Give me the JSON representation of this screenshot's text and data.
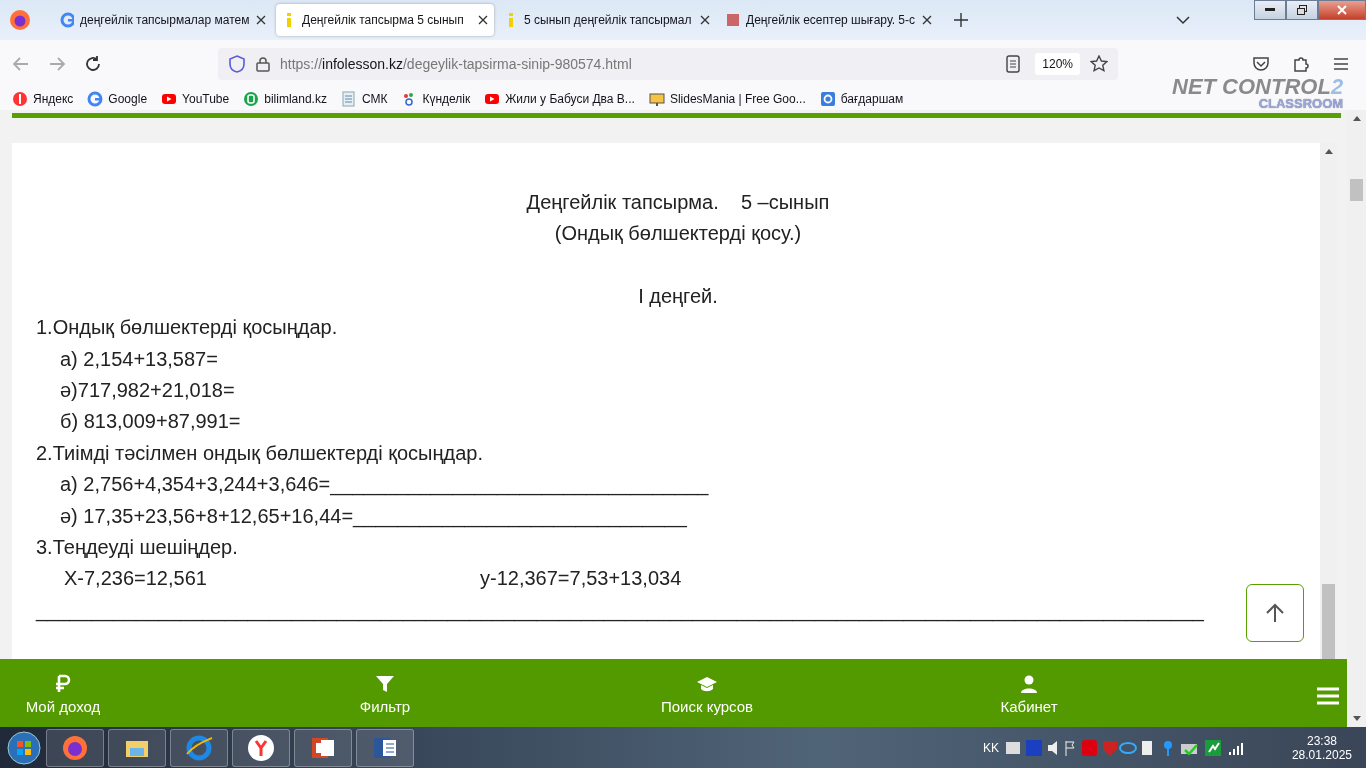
{
  "browser": {
    "tabs": [
      {
        "title": "деңгейлік тапсырмалар матем",
        "selected": false
      },
      {
        "title": "Деңгейлік тапсырма 5 сынып",
        "selected": true
      },
      {
        "title": "5 сынып деңгейлік тапсырмал",
        "selected": false
      },
      {
        "title": "Деңгейлік есептер шығару. 5-с",
        "selected": false
      }
    ],
    "url_prefix": "https://",
    "url_domain": "infolesson.kz",
    "url_path": "/degeylik-tapsirma-sinip-980574.html",
    "zoom": "120%",
    "bookmarks": [
      "Яндекс",
      "Google",
      "YouTube",
      "bilimland.kz",
      "СМК",
      "Күнделік",
      "Жили у Бабуси Два В...",
      "SlidesMania | Free Goo...",
      "бағдаршам"
    ]
  },
  "overlay": {
    "name": "NET CONTROL",
    "version": "2",
    "edition": "CLASSROOM"
  },
  "document": {
    "lines": [
      {
        "kind": "center",
        "text": "Деңгейлік тапсырма.    5 –сынып"
      },
      {
        "kind": "center",
        "text": "(Ондық бөлшектерді қосу.)"
      },
      {
        "kind": "level",
        "text": "I деңгей."
      },
      {
        "kind": "task",
        "text": "1.Ондық бөлшектерді қосыңдар."
      },
      {
        "kind": "item",
        "text": "а) 2,154+13,587="
      },
      {
        "kind": "item",
        "text": "ә)717,982+21,018="
      },
      {
        "kind": "item",
        "text": "б) 813,009+87,991="
      },
      {
        "kind": "task",
        "text": "2.Тиімді тәсілмен ондық бөлшектерді қосыңдар."
      },
      {
        "kind": "item",
        "text": "а) 2,756+4,354+3,244+3,646=__________________________________"
      },
      {
        "kind": "item",
        "text": "ә) 17,35+23,56+8+12,65+16,44=______________________________"
      },
      {
        "kind": "task",
        "text": "3.Теңдеуді шешіңдер."
      },
      {
        "kind": "pair",
        "text": "Х-7,236=12,561",
        "text2": "у-12,367=7,53+13,034"
      },
      {
        "kind": "task",
        "text": "_________________________________________________________________________________________________________"
      }
    ]
  },
  "bottom_nav": [
    "Мой доход",
    "Фильтр",
    "Поиск курсов",
    "Кабинет"
  ],
  "taskbar": {
    "language": "KK",
    "time": "23:38",
    "date": "28.01.2025"
  }
}
